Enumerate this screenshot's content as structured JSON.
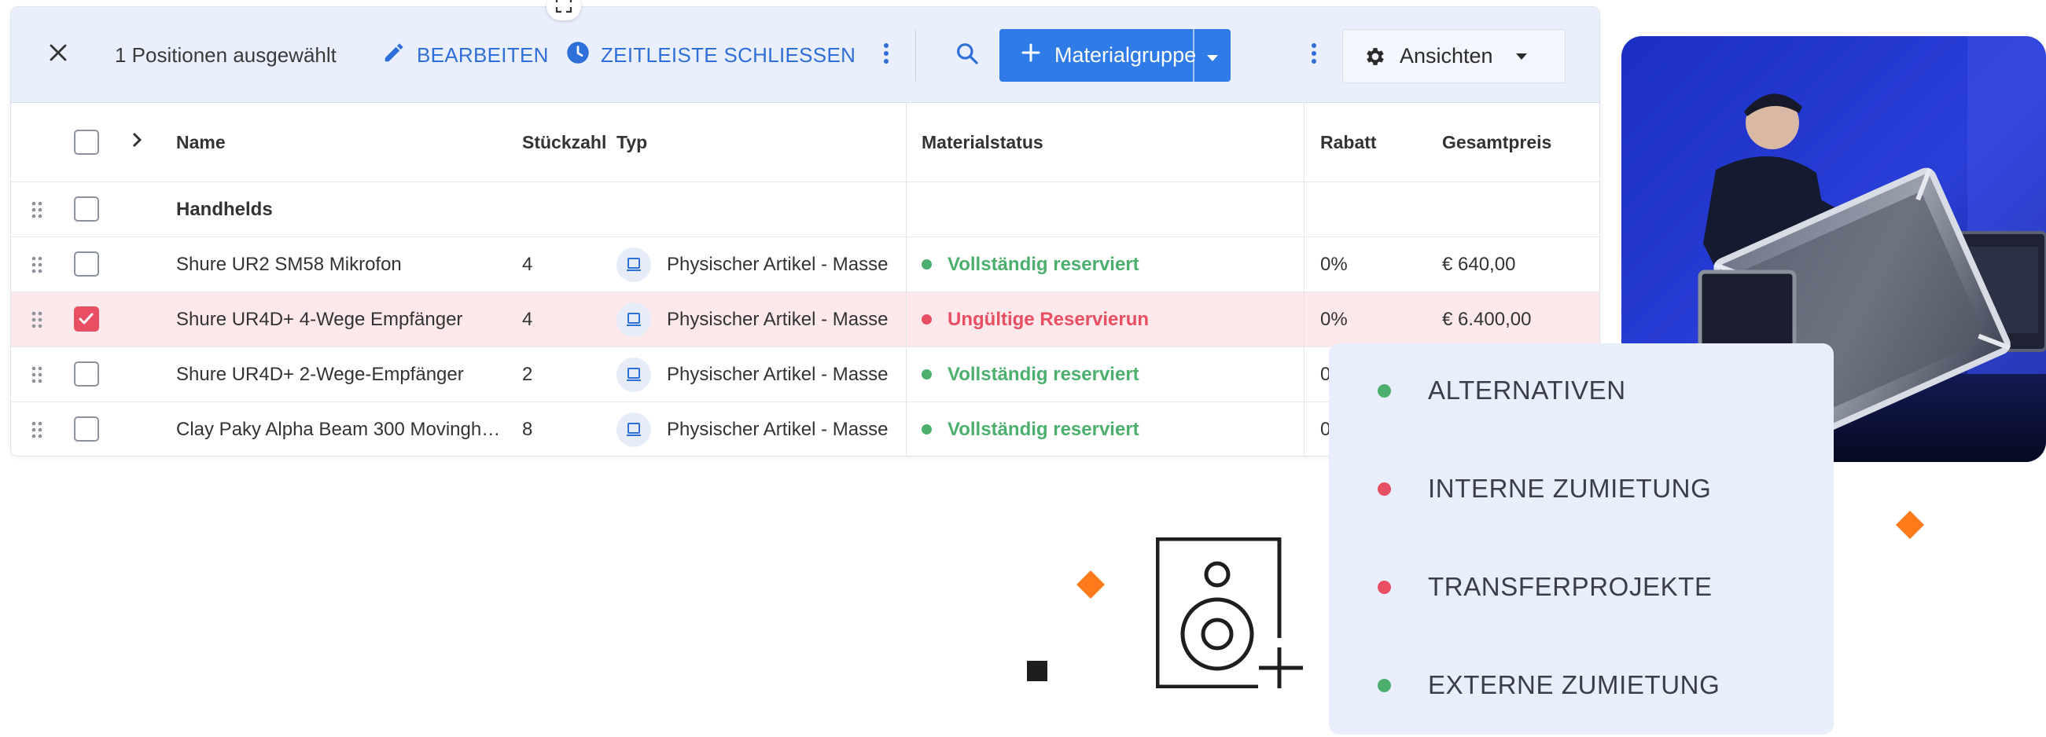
{
  "toolbar": {
    "selection_text": "1 Positionen ausgewählt",
    "edit_label": "BEARBEITEN",
    "timeline_label": "ZEITLEISTE SCHLIESSEN",
    "add_button_label": "Materialgruppe",
    "views_label": "Ansichten"
  },
  "table": {
    "columns": {
      "name": "Name",
      "quantity": "Stückzahl",
      "type": "Typ",
      "material_status": "Materialstatus",
      "discount": "Rabatt",
      "total_price": "Gesamtpreis"
    },
    "group": "Handhelds",
    "rows": [
      {
        "name": "Shure UR2 SM58 Mikrofon",
        "quantity": "4",
        "type": "Physischer Artikel - Masse",
        "status": "Vollständig reserviert",
        "status_kind": "ok",
        "discount": "0%",
        "price": "€ 640,00",
        "selected": false
      },
      {
        "name": "Shure UR4D+ 4-Wege Empfänger",
        "quantity": "4",
        "type": "Physischer Artikel - Masse",
        "status": "Ungültige Reservierun",
        "status_kind": "error",
        "discount": "0%",
        "price": "€ 6.400,00",
        "selected": true
      },
      {
        "name": "Shure UR4D+ 2-Wege-Empfänger",
        "quantity": "2",
        "type": "Physischer Artikel - Masse",
        "status": "Vollständig reserviert",
        "status_kind": "ok",
        "discount": "0",
        "price": "",
        "selected": false
      },
      {
        "name": "Clay Paky Alpha Beam 300 Movingh…",
        "quantity": "8",
        "type": "Physischer Artikel - Masse",
        "status": "Vollständig reserviert",
        "status_kind": "ok",
        "discount": "0",
        "price": "",
        "selected": false
      }
    ]
  },
  "popup": {
    "items": [
      {
        "label": "ALTERNATIVEN",
        "color": "#4caf6e"
      },
      {
        "label": "INTERNE ZUMIETUNG",
        "color": "#e94f63"
      },
      {
        "label": "TRANSFERPROJEKTE",
        "color": "#e94f63"
      },
      {
        "label": "EXTERNE ZUMIETUNG",
        "color": "#4caf6e"
      }
    ]
  },
  "colors": {
    "accent": "#2f7be8",
    "ok": "#4caf6e",
    "error": "#e94f63",
    "orange": "#ff7a1a"
  },
  "icons": [
    "close-icon",
    "pencil-icon",
    "clock-icon",
    "more-vertical-icon",
    "search-icon",
    "plus-icon",
    "caret-down-icon",
    "gear-icon",
    "chevron-right-icon",
    "drag-handle-icon",
    "laptop-icon",
    "speaker-add-icon",
    "expand-icon"
  ]
}
